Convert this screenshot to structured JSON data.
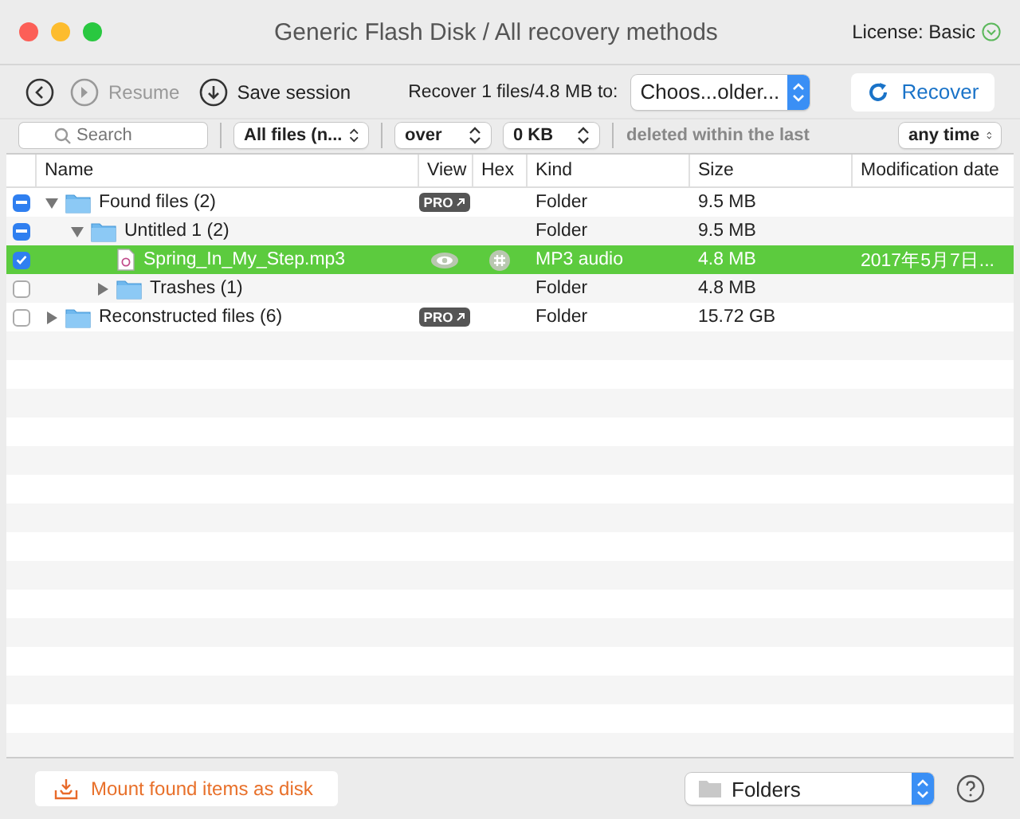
{
  "window": {
    "title": "Generic Flash Disk / All recovery methods",
    "license": "License: Basic"
  },
  "toolbar": {
    "resume": "Resume",
    "resume_disabled": true,
    "save": "Save session",
    "recover_label": "Recover 1 files/4.8 MB to:",
    "destination": "Choos...older...",
    "recover_button": "Recover"
  },
  "filters": {
    "search_placeholder": "Search",
    "type": "All files (n...",
    "size_op": "over",
    "size": "0 KB",
    "deleted_label": "deleted within the last",
    "time": "any time"
  },
  "table": {
    "columns": [
      "Name",
      "View",
      "Hex",
      "Kind",
      "Size",
      "Modification date"
    ],
    "rows": [
      {
        "kind": "folder",
        "name": "Found files (2)",
        "checked": true,
        "mixed": true,
        "expanded": true,
        "selected": false,
        "badge": "PRO",
        "type": "Folder",
        "size": "9.5 MB",
        "children": [
          {
            "kind": "folder",
            "name": "Untitled 1 (2)",
            "checked": true,
            "mixed": true,
            "expanded": true,
            "selected": false,
            "type": "Folder",
            "size": "9.5 MB",
            "children": [
              {
                "kind": "file",
                "name": "Spring_In_My_Step.mp3",
                "checked": true,
                "mixed": false,
                "selected": true,
                "preview": true,
                "hex": true,
                "type": "MP3 audio",
                "size": "4.8 MB",
                "date": "2017年5月7日..."
              },
              {
                "kind": "folder",
                "name": "Trashes (1)",
                "checked": false,
                "mixed": false,
                "expanded": false,
                "selected": false,
                "type": "Folder",
                "size": "4.8 MB"
              }
            ]
          }
        ]
      },
      {
        "kind": "folder",
        "name": "Reconstructed files (6)",
        "checked": false,
        "mixed": false,
        "expanded": false,
        "selected": false,
        "badge": "PRO",
        "type": "Folder",
        "size": "15.72 GB"
      }
    ]
  },
  "footer": {
    "mount": "Mount found items as disk",
    "view_mode": "Folders"
  }
}
